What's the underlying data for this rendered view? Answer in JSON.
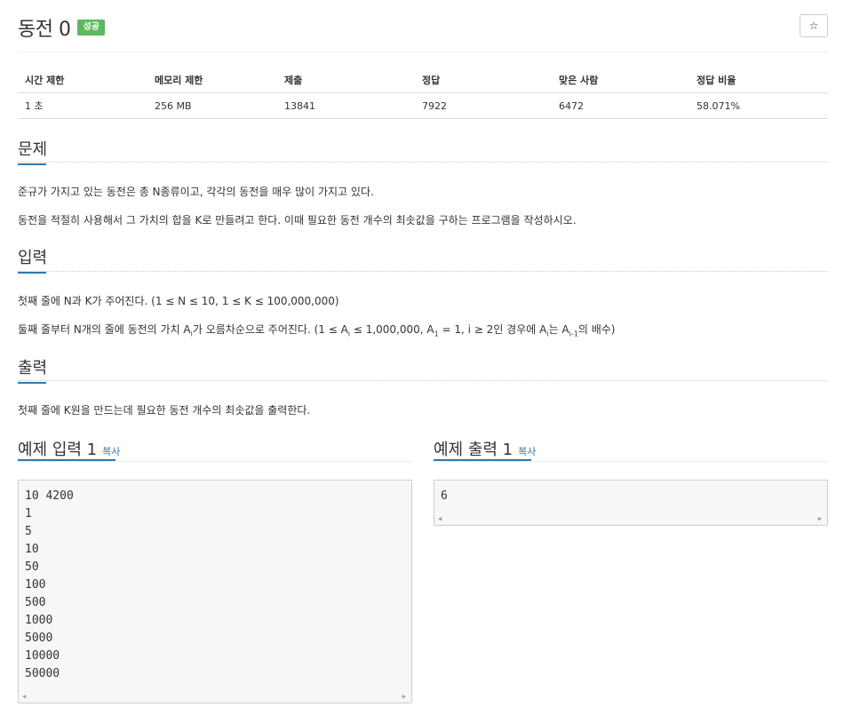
{
  "problem": {
    "title": "동전 0",
    "status_badge": "성공",
    "star_glyph": "☆"
  },
  "info_table": {
    "headers": [
      "시간 제한",
      "메모리 제한",
      "제출",
      "정답",
      "맞은 사람",
      "정답 비율"
    ],
    "values": [
      "1 초",
      "256 MB",
      "13841",
      "7922",
      "6472",
      "58.071%"
    ]
  },
  "sections": {
    "problem": {
      "heading": "문제",
      "lines": [
        "준규가 가지고 있는 동전은 총 N종류이고, 각각의 동전을 매우 많이 가지고 있다.",
        "동전을 적절히 사용해서 그 가치의 합을 K로 만들려고 한다. 이때 필요한 동전 개수의 최솟값을 구하는 프로그램을 작성하시오."
      ]
    },
    "input": {
      "heading": "입력",
      "line1": "첫째 줄에 N과 K가 주어진다. (1 ≤ N ≤ 10, 1 ≤ K ≤ 100,000,000)",
      "line2": {
        "p1": "둘째 줄부터 N개의 줄에 동전의 가치 A",
        "s1": "i",
        "p2": "가 오름차순으로 주어진다. (1 ≤ A",
        "s2": "i",
        "p3": " ≤ 1,000,000, A",
        "s3": "1",
        "p4": " = 1, i ≥ 2인 경우에 A",
        "s4": "i",
        "p5": "는 A",
        "s5": "i-1",
        "p6": "의 배수)"
      }
    },
    "output": {
      "heading": "출력",
      "line": "첫째 줄에 K원을 만드는데 필요한 동전 개수의 최솟값을 출력한다."
    }
  },
  "examples": {
    "input": {
      "title": "예제 입력 1",
      "copy_label": "복사",
      "lines": [
        "10 4200",
        "1",
        "5",
        "10",
        "50",
        "100",
        "500",
        "1000",
        "5000",
        "10000",
        "50000"
      ]
    },
    "output": {
      "title": "예제 출력 1",
      "copy_label": "복사",
      "lines": [
        "6"
      ]
    }
  },
  "colors": {
    "accent": "#2a7ab0",
    "success": "#5cb85c"
  },
  "icons": [
    "star-icon",
    "scroll-left-icon",
    "scroll-right-icon"
  ]
}
